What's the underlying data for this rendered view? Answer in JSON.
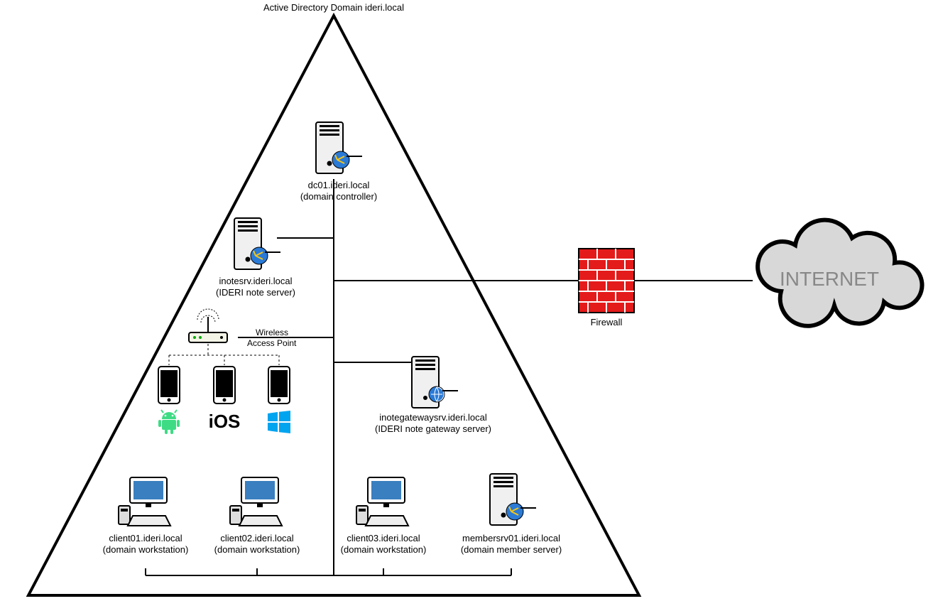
{
  "title": "Active Directory Domain ideri.local",
  "nodes": {
    "dc01": {
      "name": "dc01.ideri.local",
      "role": "(domain controller)"
    },
    "inotesrv": {
      "name": "inotesrv.ideri.local",
      "role": "(IDERI note server)"
    },
    "gateway": {
      "name": "inotegatewaysrv.ideri.local",
      "role": "(IDERI note gateway server)"
    },
    "client01": {
      "name": "client01.ideri.local",
      "role": "(domain workstation)"
    },
    "client02": {
      "name": "client02.ideri.local",
      "role": "(domain workstation)"
    },
    "client03": {
      "name": "client03.ideri.local",
      "role": "(domain workstation)"
    },
    "membersrv": {
      "name": "membersrv01.ideri.local",
      "role": "(domain member server)"
    },
    "wap": {
      "name": "Wireless",
      "role": "Access Point"
    },
    "firewall": {
      "name": "Firewall"
    },
    "internet": {
      "name": "INTERNET"
    },
    "ios": {
      "label": "iOS"
    }
  }
}
